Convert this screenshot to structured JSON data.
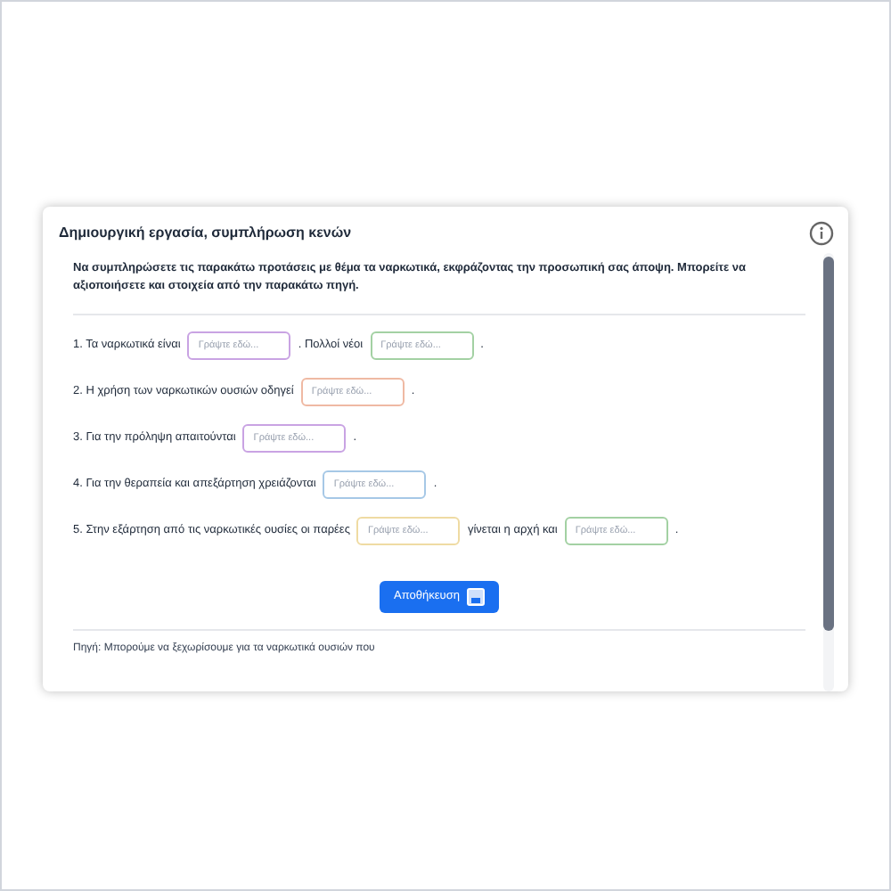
{
  "card": {
    "title": "Δημιουργική εργασία, συμπλήρωση κενών",
    "instructions": "Να συμπληρώσετε τις παρακάτω προτάσεις με θέμα τα ναρκωτικά, εκφράζοντας την προσωπική σας άποψη. Μπορείτε να αξιοποιήσετε και στοιχεία από την παρακάτω πηγή.",
    "sentences": [
      {
        "parts": [
          {
            "kind": "text",
            "text": "1. Τα ναρκωτικά είναι"
          },
          {
            "kind": "blank",
            "placeholder": "Γράψτε εδώ...",
            "color": "#c9a3e3"
          },
          {
            "kind": "text",
            "text": ". Πολλοί νέοι"
          },
          {
            "kind": "blank",
            "placeholder": "Γράψτε εδώ...",
            "color": "#a3d1a3"
          },
          {
            "kind": "text",
            "text": "."
          }
        ]
      },
      {
        "parts": [
          {
            "kind": "text",
            "text": "2. Η χρήση των ναρκωτικών ουσιών οδηγεί"
          },
          {
            "kind": "blank",
            "placeholder": "Γράψτε εδώ...",
            "color": "#efb9a3"
          },
          {
            "kind": "text",
            "text": "."
          }
        ]
      },
      {
        "parts": [
          {
            "kind": "text",
            "text": "3. Για την πρόληψη απαιτούνται"
          },
          {
            "kind": "blank",
            "placeholder": "Γράψτε εδώ...",
            "color": "#c9a3e3"
          },
          {
            "kind": "text",
            "text": "."
          }
        ]
      },
      {
        "parts": [
          {
            "kind": "text",
            "text": "4. Για την θεραπεία και απεξάρτηση χρειάζονται"
          },
          {
            "kind": "blank",
            "placeholder": "Γράψτε εδώ...",
            "color": "#a6c8e6"
          },
          {
            "kind": "text",
            "text": "."
          }
        ]
      },
      {
        "parts": [
          {
            "kind": "text",
            "text": "5. Στην εξάρτηση από τις ναρκωτικές ουσίες οι παρέες"
          },
          {
            "kind": "blank",
            "placeholder": "Γράψτε εδώ...",
            "color": "#efdba3"
          },
          {
            "kind": "text",
            "text": "γίνεται η αρχή και"
          },
          {
            "kind": "blank",
            "placeholder": "Γράψτε εδώ...",
            "color": "#a3d1a3"
          },
          {
            "kind": "text",
            "text": "."
          }
        ]
      }
    ],
    "save_button": "Αποθήκευση",
    "source": "Πηγή: Μπορούμε να ξεχωρίσουμε για τα ναρκωτικά ουσιών που"
  }
}
